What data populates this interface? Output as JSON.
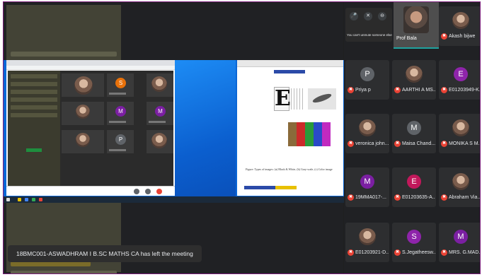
{
  "notification": "18BMC001-ASWADHRAM I B.SC MATHS CA has left the meeting",
  "host": {
    "name": "Prof Bala"
  },
  "controls": {
    "hint": "You can't unmute someone else",
    "mic_icon": "mic-icon",
    "mute_icon": "mic-off-icon",
    "remove_icon": "remove-icon"
  },
  "participants": [
    {
      "name": "Akash bijwe",
      "avatar": "",
      "color": "",
      "photo": true
    },
    {
      "name": "Priya p",
      "avatar": "P",
      "color": "#5f6368",
      "photo": false
    },
    {
      "name": "AARTHI A MS...",
      "avatar": "",
      "color": "",
      "photo": true
    },
    {
      "name": "E01203949-K...",
      "avatar": "E",
      "color": "#8e24aa",
      "photo": false
    },
    {
      "name": "veronica john...",
      "avatar": "",
      "color": "",
      "photo": true
    },
    {
      "name": "Maisa Chand...",
      "avatar": "M",
      "color": "#5f6368",
      "photo": false
    },
    {
      "name": "MONIKA S M...",
      "avatar": "",
      "color": "",
      "photo": true
    },
    {
      "name": "19MMA017-...",
      "avatar": "M",
      "color": "#7b1fa2",
      "photo": false
    },
    {
      "name": "E01203635-A...",
      "avatar": "E",
      "color": "#c2185b",
      "photo": false
    },
    {
      "name": "Abraham Via...",
      "avatar": "",
      "color": "",
      "photo": true
    },
    {
      "name": "E01203921-D...",
      "avatar": "",
      "color": "",
      "photo": true
    },
    {
      "name": "S.Jegatheesw...",
      "avatar": "S",
      "color": "#8e24aa",
      "photo": false
    },
    {
      "name": "MRS. G.MAD...",
      "avatar": "M",
      "color": "#7b1fa2",
      "photo": false
    }
  ],
  "shared_screen": {
    "doc_caption": "Figure: Types of images: (a) Black & White, (b) Gray-scale, (c) Color image",
    "nested_avatars": [
      {
        "letter": "S",
        "color": "#e8710a"
      },
      {
        "letter": "M",
        "color": "#7b1fa2"
      },
      {
        "letter": "M",
        "color": "#7b1fa2"
      },
      {
        "letter": "P",
        "color": "#5f6368"
      }
    ]
  }
}
